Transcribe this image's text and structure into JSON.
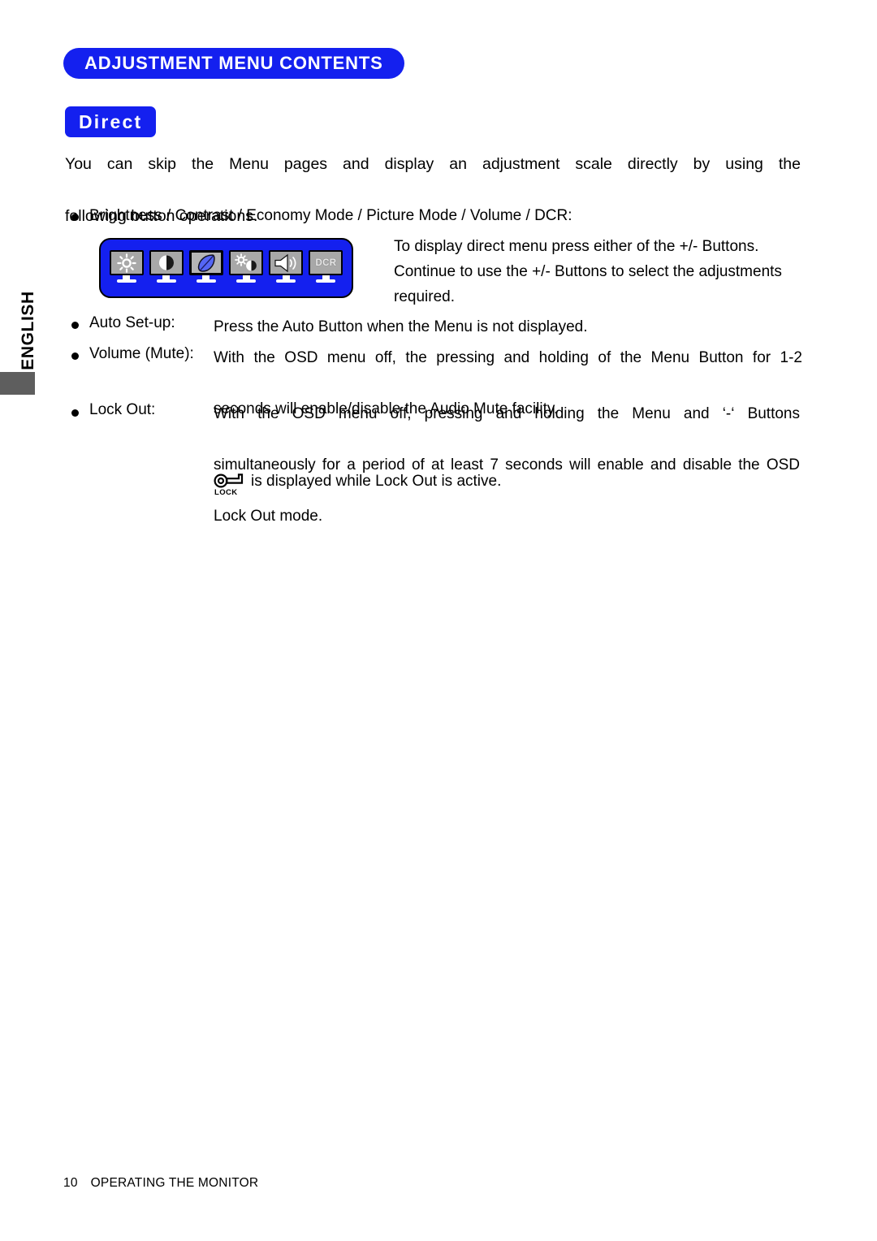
{
  "document": {
    "language_tab": "ENGLISH",
    "header_title": "ADJUSTMENT MENU CONTENTS",
    "section_badge": "Direct",
    "intro": {
      "line1": "You can skip the Menu pages and display an adjustment scale directly by using the",
      "line2": "following button operations."
    },
    "direct_bullet": {
      "bullet": "●",
      "label": "Brightness / Contrast / Economy Mode / Picture Mode / Volume / DCR:"
    },
    "icon_panel": {
      "background_color": "#1420ef",
      "items": [
        {
          "name": "brightness-icon",
          "glyph": "sun",
          "label": "Brightness",
          "selected": false
        },
        {
          "name": "contrast-icon",
          "glyph": "half-circle",
          "label": "Contrast",
          "selected": false
        },
        {
          "name": "economy-mode-icon",
          "glyph": "leaf",
          "label": "Economy Mode",
          "selected": true
        },
        {
          "name": "picture-mode-icon",
          "glyph": "sun-and-half-circle",
          "label": "Picture Mode",
          "selected": false
        },
        {
          "name": "volume-icon",
          "glyph": "speaker",
          "label": "Volume",
          "selected": false
        },
        {
          "name": "dcr-icon",
          "glyph": "text",
          "label": "DCR",
          "selected": false
        }
      ]
    },
    "direct_description": {
      "line1": "To display direct menu press either of the +/- Buttons.",
      "line2": "Continue to use the +/- Buttons to select the adjustments",
      "line3": "required."
    },
    "items": [
      {
        "bullet": "●",
        "label": "Auto Set-up:",
        "lines": [
          "Press the Auto Button when the Menu is not displayed."
        ]
      },
      {
        "bullet": "●",
        "label": "Volume (Mute):",
        "lines": [
          "With the OSD menu off, the pressing and holding of the Menu Button for 1-2",
          "seconds will enable/disable the Audio Mute facility."
        ]
      },
      {
        "bullet": "●",
        "label": "Lock Out:",
        "lines": [
          "With the OSD menu off, pressing and holding the Menu and ‘-‘ Buttons",
          "simultaneously for a period of at least 7 seconds will enable and disable the OSD",
          "Lock Out mode."
        ]
      }
    ],
    "lock_note": {
      "icon_name": "lock-key-icon",
      "icon_caption": "LOCK",
      "text": "is displayed while Lock Out is active."
    },
    "footer": {
      "page_number": "10",
      "section": "OPERATING THE MONITOR"
    }
  }
}
